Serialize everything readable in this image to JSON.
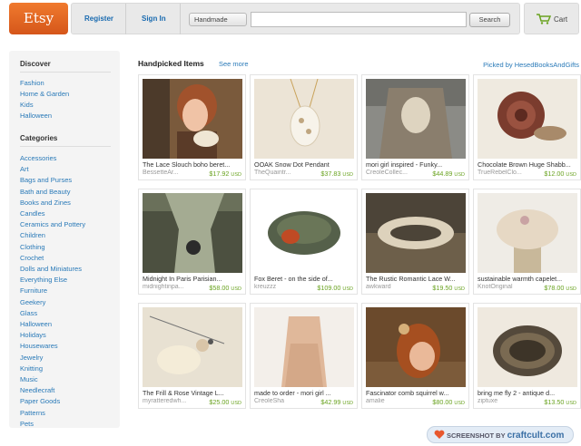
{
  "header": {
    "logo": "Etsy",
    "register": "Register",
    "sign_in": "Sign In",
    "category": "Handmade",
    "search_value": "",
    "search_button": "Search",
    "cart": "Cart"
  },
  "sidebar": {
    "discover_heading": "Discover",
    "discover": [
      "Fashion",
      "Home & Garden",
      "Kids",
      "Halloween"
    ],
    "categories_heading": "Categories",
    "categories": [
      "Accessories",
      "Art",
      "Bags and Purses",
      "Bath and Beauty",
      "Books and Zines",
      "Candles",
      "Ceramics and Pottery",
      "Children",
      "Clothing",
      "Crochet",
      "Dolls and Miniatures",
      "Everything Else",
      "Furniture",
      "Geekery",
      "Glass",
      "Halloween",
      "Holidays",
      "Housewares",
      "Jewelry",
      "Knitting",
      "Music",
      "Needlecraft",
      "Paper Goods",
      "Patterns",
      "Pets"
    ]
  },
  "main": {
    "title": "Handpicked Items",
    "see_more": "See more",
    "picked_by": "Picked by HesedBooksAndGifts",
    "currency": "USD",
    "items": [
      {
        "title": "The Lace Slouch boho beret...",
        "shop": "BessetteAr...",
        "price": "$17.92"
      },
      {
        "title": "OOAK Snow Dot Pendant",
        "shop": "TheQuaintr...",
        "price": "$37.83"
      },
      {
        "title": "mori girl inspired - Funky...",
        "shop": "CreoleCollec...",
        "price": "$44.89"
      },
      {
        "title": "Chocolate Brown Huge Shabb...",
        "shop": "TrueRebelClo...",
        "price": "$12.00"
      },
      {
        "title": "Midnight In Paris Parisian...",
        "shop": "midnightinpa...",
        "price": "$58.00"
      },
      {
        "title": "Fox Beret - on the side of...",
        "shop": "kreuzzz",
        "price": "$109.00"
      },
      {
        "title": "The Rustic Romantic Lace W...",
        "shop": "awkward",
        "price": "$19.50"
      },
      {
        "title": "sustainable warmth capelet...",
        "shop": "KnotOriginal",
        "price": "$78.00"
      },
      {
        "title": "The Frill & Rose Vintage L...",
        "shop": "myratteredwh...",
        "price": "$25.00"
      },
      {
        "title": "made to order - mori girl ...",
        "shop": "CreoleSha",
        "price": "$42.99"
      },
      {
        "title": "Fascinator comb squirrel w...",
        "shop": "amalie",
        "price": "$80.00"
      },
      {
        "title": "bring me fly 2 - antique d...",
        "shop": "ziptuxe",
        "price": "$13.50"
      }
    ]
  },
  "watermark": {
    "prefix": "SCREENSHOT BY",
    "brand": "craftcult.com"
  },
  "icons": [
    "cart-icon",
    "heart-icon"
  ]
}
